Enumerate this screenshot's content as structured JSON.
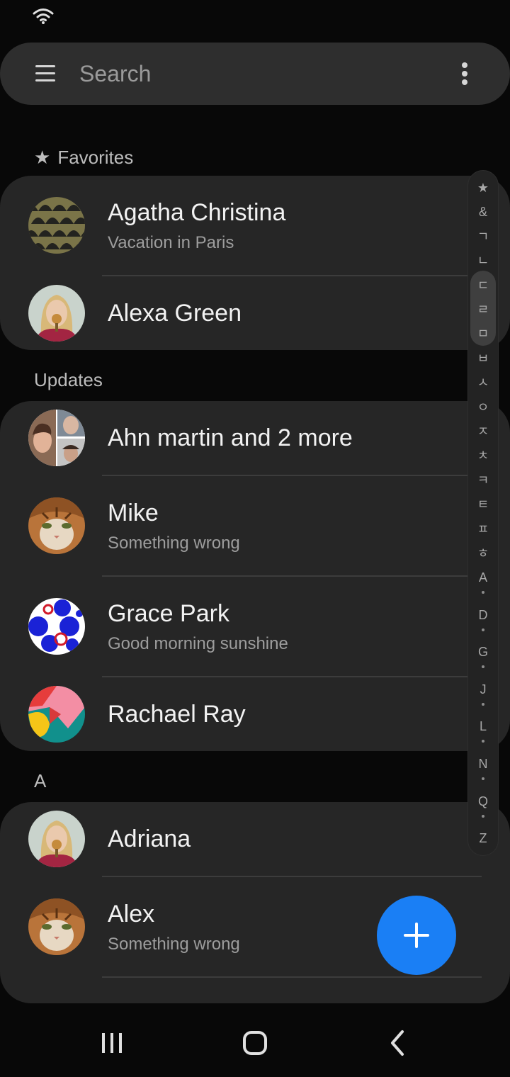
{
  "search": {
    "placeholder": "Search"
  },
  "favorites": {
    "header": "Favorites",
    "contacts": [
      {
        "name": "Agatha Christina",
        "status": "Vacation in Paris",
        "avatar": "pattern-avatar"
      },
      {
        "name": "Alexa Green",
        "status": "",
        "avatar": "woman-photo-avatar"
      }
    ]
  },
  "updates": {
    "header": "Updates",
    "contacts": [
      {
        "name": "Ahn martin and 2 more",
        "status": "",
        "avatar": "group-collage-avatar"
      },
      {
        "name": "Mike",
        "status": "Something wrong",
        "avatar": "cat-photo-avatar"
      },
      {
        "name": "Grace Park",
        "status": "Good morning sunshine",
        "avatar": "blue-circles-avatar"
      },
      {
        "name": "Rachael Ray",
        "status": "",
        "avatar": "geometric-avatar"
      }
    ]
  },
  "section_a": {
    "header": "A",
    "contacts": [
      {
        "name": "Adriana",
        "status": "",
        "avatar": "woman-photo-avatar"
      },
      {
        "name": "Alex",
        "status": "Something wrong",
        "avatar": "cat-photo-avatar"
      }
    ]
  },
  "index_bar": {
    "items": [
      "★",
      "&",
      "ㄱ",
      "ㄴ",
      "ㄷ",
      "ㄹ",
      "ㅁ",
      "ㅂ",
      "ㅅ",
      "ㅇ",
      "ㅈ",
      "ㅊ",
      "ㅋ",
      "ㅌ",
      "ㅍ",
      "ㅎ",
      "A",
      "D",
      "G",
      "J",
      "L",
      "N",
      "Q",
      "Z"
    ]
  },
  "colors": {
    "background": "#080808",
    "card": "#262626",
    "search_bar": "#2e2e2e",
    "accent": "#1a7ff5"
  },
  "icons": {
    "status_bar": "wifi-icon",
    "menu": "hamburger-menu-icon",
    "more": "more-vertical-icon",
    "favorites": "star-icon",
    "fab": "plus-icon",
    "nav": [
      "recent-apps-icon",
      "home-icon",
      "back-icon"
    ]
  }
}
